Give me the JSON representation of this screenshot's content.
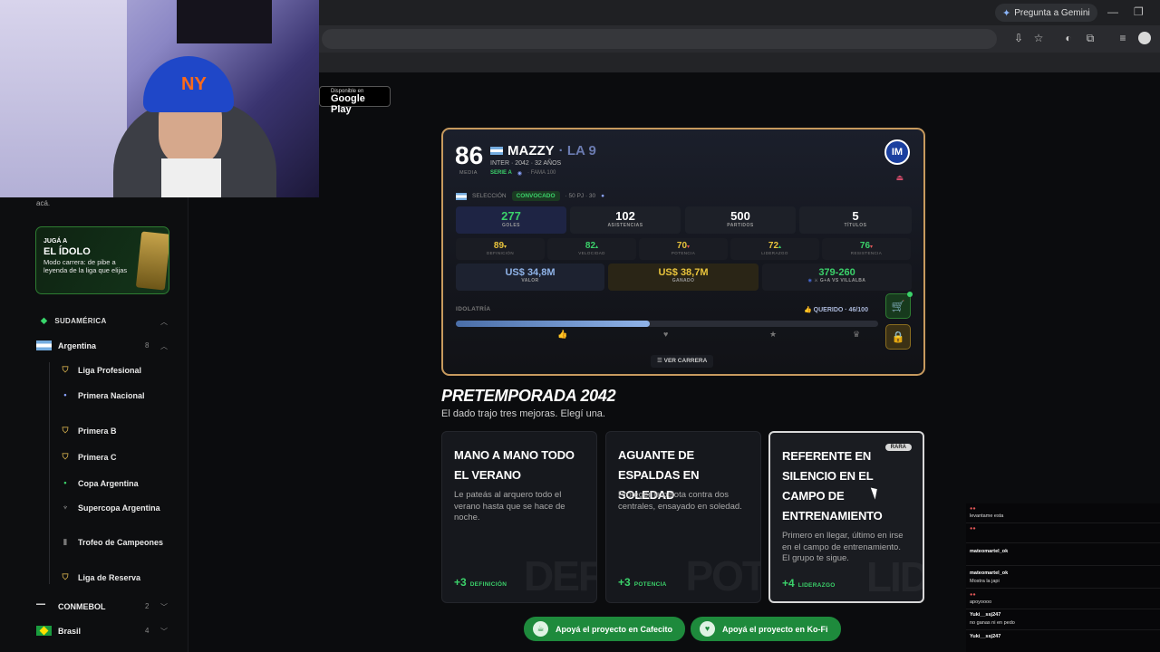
{
  "browser": {
    "gemini_label": "Pregunta a Gemini"
  },
  "gplay": {
    "small": "Disponible en",
    "big": "Google Play"
  },
  "sidebar": {
    "hint": "acá.",
    "promo": {
      "kicker": "JUGÁ A",
      "title": "EL ÍDOLO",
      "desc": "Modo carrera: de pibe a leyenda de la liga que elijas"
    },
    "section": "SUDAMÉRICA",
    "argentina": {
      "label": "Argentina",
      "count": "8"
    },
    "leagues": [
      "Liga Profesional",
      "Primera Nacional",
      "Primera B",
      "Primera C",
      "Copa Argentina",
      "Supercopa Argentina",
      "Trofeo de Campeones",
      "Liga de Reserva"
    ],
    "conmebol": {
      "label": "CONMEBOL",
      "count": "2"
    },
    "brasil": {
      "label": "Brasil",
      "count": "4"
    }
  },
  "career": {
    "ovr": "86",
    "ovr_label": "MEDIA",
    "name": "MAZZY",
    "number": "· LA 9",
    "info": "INTER · 2042 · 32 AÑOS",
    "liga": "SERIE A",
    "fama": "· FAMA 100",
    "club_short": "IM",
    "seleccion_label": "SELECCIÓN",
    "convocado": "CONVOCADO",
    "sel_stats": "· 50 PJ · 30",
    "stats": [
      {
        "value": "277",
        "label": "GOLES"
      },
      {
        "value": "102",
        "label": "ASISTENCIAS"
      },
      {
        "value": "500",
        "label": "PARTIDOS"
      },
      {
        "value": "5",
        "label": "TÍTULOS"
      }
    ],
    "attributes": [
      {
        "value": "89",
        "arrow": "▾",
        "label": "DEFINICIÓN",
        "color": "#e9c43c"
      },
      {
        "value": "82",
        "arrow": "▴",
        "label": "VELOCIDAD",
        "color": "#3bd16a"
      },
      {
        "value": "70",
        "arrow": "▾",
        "label": "POTENCIA",
        "color": "#e9c43c"
      },
      {
        "value": "72",
        "arrow": "▴",
        "label": "LIDERAZGO",
        "color": "#e9c43c"
      },
      {
        "value": "76",
        "arrow": "▾",
        "label": "RESISTENCIA",
        "color": "#3bd16a"
      }
    ],
    "valor": {
      "value": "US$ 34,8M",
      "label": "VALOR"
    },
    "ganado": {
      "value": "US$ 38,7M",
      "label": "GANADO"
    },
    "record": {
      "value": "379-260",
      "label": "G+A VS VILLALBA"
    },
    "idolatria_label": "IDOLATRÍA",
    "idolatria_status": "QUERIDO · 46/100",
    "idolatria_value": 46,
    "idolatria_max": 100,
    "ver_carrera": "VER CARRERA"
  },
  "preseason": {
    "title": "PRETEMPORADA 2042",
    "subtitle": "El dado trajo tres mejoras. Elegí una.",
    "perks": [
      {
        "title": "MANO A MANO TODO EL VERANO",
        "desc": "Le pateás al arquero todo el verano hasta que se hace de noche.",
        "bonus": "+3",
        "bonus_label": "DEFINICIÓN",
        "watermark": "DEF"
      },
      {
        "title": "AGUANTE DE ESPALDAS EN SOLEDAD",
        "desc": "Proteger la pelota contra dos centrales, ensayado en soledad.",
        "bonus": "+3",
        "bonus_label": "POTENCIA",
        "watermark": "POT"
      },
      {
        "title": "REFERENTE EN SILENCIO EN EL CAMPO DE ENTRENAMIENTO",
        "desc": "Primero en llegar, último en irse en el campo de entrenamiento. El grupo te sigue.",
        "bonus": "+4",
        "bonus_label": "LIDERAZGO",
        "watermark": "LID",
        "badge": "RARA"
      }
    ]
  },
  "support": {
    "cafecito": "Apoyá el proyecto en Cafecito",
    "kofi": "Apoyá el proyecto en Ko-Fi"
  },
  "chat": [
    {
      "name": "",
      "msg": "levantame esta"
    },
    {
      "name": "",
      "msg": ""
    },
    {
      "name": "mateomartel_ok",
      "msg": ""
    },
    {
      "name": "mateomartel_ok",
      "msg": "Mostra la japi"
    },
    {
      "name": "",
      "msg": "apoyoooo"
    },
    {
      "name": "Yuki__ssj247",
      "msg": "no ganas ni en pedo"
    },
    {
      "name": "Yuki__ssj247",
      "msg": ""
    }
  ]
}
